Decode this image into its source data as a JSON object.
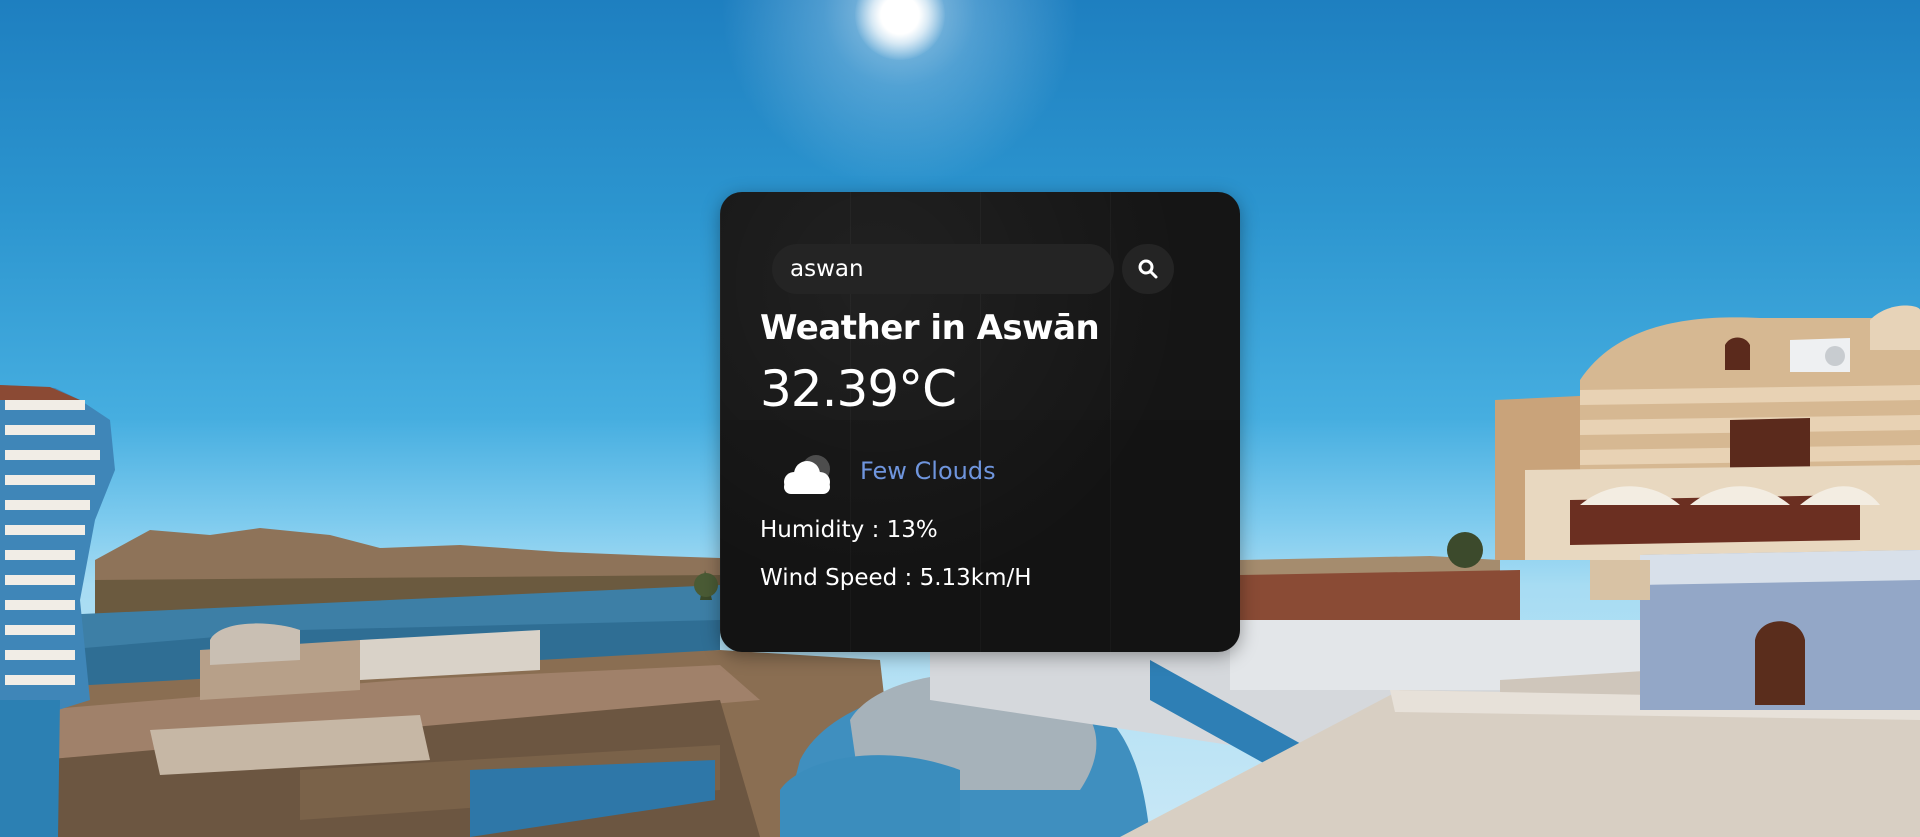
{
  "search": {
    "value": "aswan",
    "button_icon": "search-icon"
  },
  "weather": {
    "title": "Weather in Aswān",
    "temperature": "32.39°C",
    "condition_icon": "few-clouds-icon",
    "condition": "Few Clouds",
    "humidity": "Humidity : 13%",
    "wind": "Wind Speed : 5.13km/H"
  },
  "colors": {
    "card_background": "#151515",
    "input_background": "#242424",
    "condition_text": "#6f95dd",
    "sky": "#2c95cf"
  }
}
